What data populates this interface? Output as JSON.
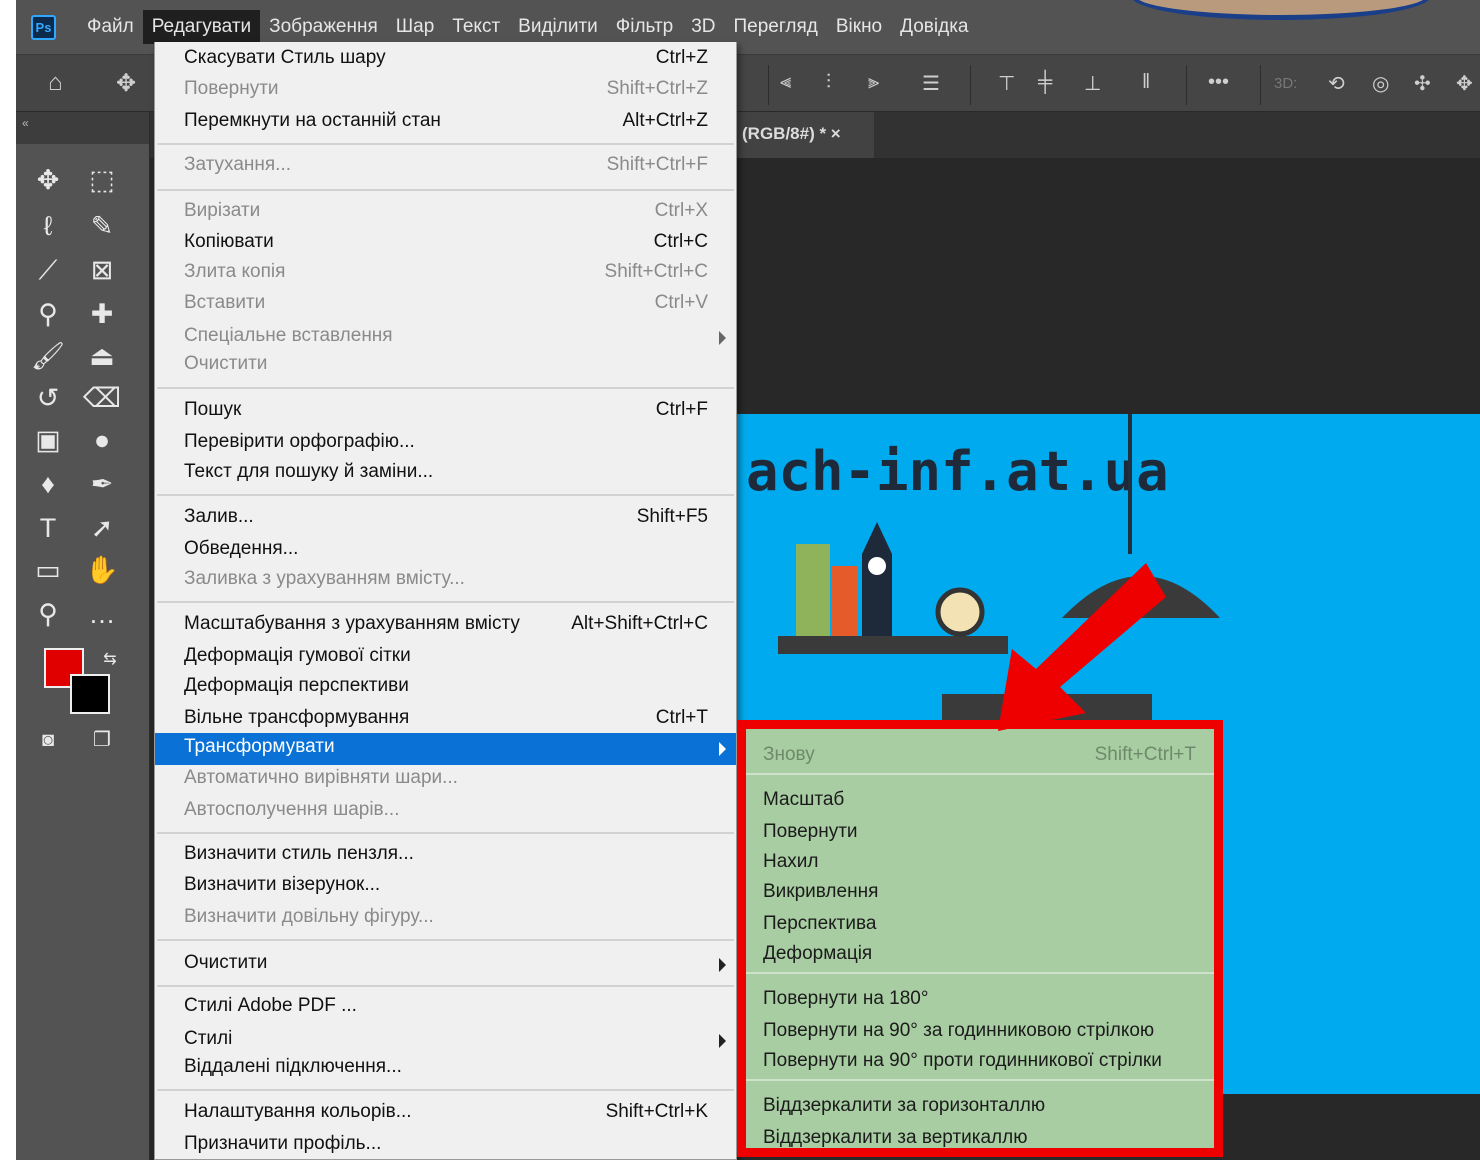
{
  "menubar": {
    "logo": "Ps",
    "items": [
      "Файл",
      "Редагувати",
      "Зображення",
      "Шар",
      "Текст",
      "Виділити",
      "Фільтр",
      "3D",
      "Перегляд",
      "Вікно",
      "Довідка"
    ],
    "active_index": 1
  },
  "optionsbar": {
    "label_3d": "3D:",
    "more": "•••"
  },
  "document_tab": {
    "title": "(RGB/8#) * ×"
  },
  "canvas": {
    "site_text": "ach-inf.at.ua",
    "background_color": "#00aaee"
  },
  "colors": {
    "foreground": "#e00000",
    "background": "#000000",
    "highlight": "#0a72d6",
    "submenu_bg": "#a8cda2",
    "callout": "#ef0000"
  },
  "edit_menu": [
    {
      "label": "Скасувати Стиль шару",
      "shortcut": "Ctrl+Z",
      "enabled": true
    },
    {
      "label": "Повернути",
      "shortcut": "Shift+Ctrl+Z",
      "enabled": false
    },
    {
      "label": "Перемкнути на останній стан",
      "shortcut": "Alt+Ctrl+Z",
      "enabled": true
    },
    {
      "label": "Затухання...",
      "shortcut": "Shift+Ctrl+F",
      "enabled": false
    },
    {
      "label": "Вирізати",
      "shortcut": "Ctrl+X",
      "enabled": false
    },
    {
      "label": "Копіювати",
      "shortcut": "Ctrl+C",
      "enabled": true
    },
    {
      "label": "Злита копія",
      "shortcut": "Shift+Ctrl+C",
      "enabled": false
    },
    {
      "label": "Вставити",
      "shortcut": "Ctrl+V",
      "enabled": false
    },
    {
      "label": "Спеціальне вставлення",
      "shortcut": "",
      "enabled": false,
      "submenu": true
    },
    {
      "label": "Очистити",
      "shortcut": "",
      "enabled": false
    },
    {
      "label": "Пошук",
      "shortcut": "Ctrl+F",
      "enabled": true
    },
    {
      "label": "Перевірити орфографію...",
      "shortcut": "",
      "enabled": true
    },
    {
      "label": "Текст для пошуку й заміни...",
      "shortcut": "",
      "enabled": true
    },
    {
      "label": "Залив...",
      "shortcut": "Shift+F5",
      "enabled": true
    },
    {
      "label": "Обведення...",
      "shortcut": "",
      "enabled": true
    },
    {
      "label": "Заливка з урахуванням вмісту...",
      "shortcut": "",
      "enabled": false
    },
    {
      "label": "Масштабування з урахуванням вмісту",
      "shortcut": "Alt+Shift+Ctrl+C",
      "enabled": true
    },
    {
      "label": "Деформація гумової сітки",
      "shortcut": "",
      "enabled": true
    },
    {
      "label": "Деформація перспективи",
      "shortcut": "",
      "enabled": true
    },
    {
      "label": "Вільне трансформування",
      "shortcut": "Ctrl+T",
      "enabled": true
    },
    {
      "label": "Трансформувати",
      "shortcut": "",
      "enabled": true,
      "submenu": true,
      "highlighted": true
    },
    {
      "label": "Автоматично вирівняти шари...",
      "shortcut": "",
      "enabled": false
    },
    {
      "label": "Автосполучення шарів...",
      "shortcut": "",
      "enabled": false
    },
    {
      "label": "Визначити стиль пензля...",
      "shortcut": "",
      "enabled": true
    },
    {
      "label": "Визначити візерунок...",
      "shortcut": "",
      "enabled": true
    },
    {
      "label": "Визначити довільну фігуру...",
      "shortcut": "",
      "enabled": false
    },
    {
      "label": "Очистити",
      "shortcut": "",
      "enabled": true,
      "submenu": true
    },
    {
      "label": "Стилі Adobe PDF ...",
      "shortcut": "",
      "enabled": true
    },
    {
      "label": "Стилі",
      "shortcut": "",
      "enabled": true,
      "submenu": true
    },
    {
      "label": "Віддалені підключення...",
      "shortcut": "",
      "enabled": true
    },
    {
      "label": "Налаштування кольорів...",
      "shortcut": "Shift+Ctrl+K",
      "enabled": true
    },
    {
      "label": "Призначити профіль...",
      "shortcut": "",
      "enabled": true
    }
  ],
  "transform_submenu": [
    {
      "label": "Знову",
      "shortcut": "Shift+Ctrl+T",
      "enabled": false
    },
    {
      "label": "Масштаб",
      "shortcut": "",
      "enabled": true
    },
    {
      "label": "Повернути",
      "shortcut": "",
      "enabled": true
    },
    {
      "label": "Нахил",
      "shortcut": "",
      "enabled": true
    },
    {
      "label": "Викривлення",
      "shortcut": "",
      "enabled": true
    },
    {
      "label": "Перспектива",
      "shortcut": "",
      "enabled": true
    },
    {
      "label": "Деформація",
      "shortcut": "",
      "enabled": true
    },
    {
      "label": "Повернути на 180°",
      "shortcut": "",
      "enabled": true
    },
    {
      "label": "Повернути на 90° за годинниковою стрілкою",
      "shortcut": "",
      "enabled": true
    },
    {
      "label": "Повернути на 90° проти годинникової стрілки",
      "shortcut": "",
      "enabled": true
    },
    {
      "label": "Віддзеркалити за горизонталлю",
      "shortcut": "",
      "enabled": true
    },
    {
      "label": "Віддзеркалити за вертикаллю",
      "shortcut": "",
      "enabled": true
    }
  ]
}
